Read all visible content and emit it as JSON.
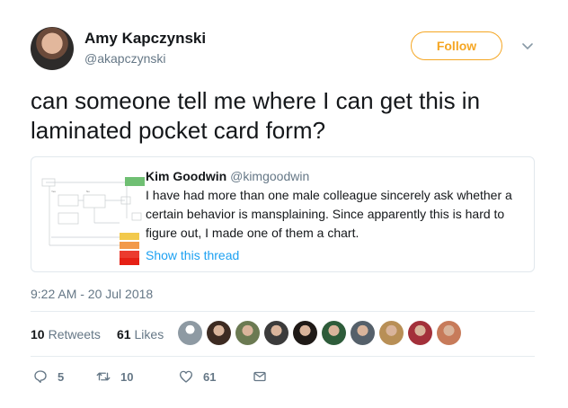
{
  "author": {
    "name": "Amy Kapczynski",
    "handle": "@akapczynski"
  },
  "follow_label": "Follow",
  "tweet_text": "can someone tell me where I can get this in laminated pocket card form?",
  "quoted": {
    "name": "Kim Goodwin",
    "handle": "@kimgoodwin",
    "text": "I have had more than one male colleague sincerely ask whether a certain behavior is mansplaining. Since apparently this is hard to figure out, I made one of them a chart.",
    "show_thread": "Show this thread",
    "thumb_labels": [
      "Yes",
      "No",
      "Yes",
      "No",
      "Yes"
    ]
  },
  "timestamp": "9:22 AM - 20 Jul 2018",
  "stats": {
    "retweets_count": "10",
    "retweets_label": "Retweets",
    "likes_count": "61",
    "likes_label": "Likes"
  },
  "likers": [
    {
      "color": "#8e9aa3"
    },
    {
      "color": "#3d2b22"
    },
    {
      "color": "#6b7a52"
    },
    {
      "color": "#3b3b3b"
    },
    {
      "color": "#1f1a17"
    },
    {
      "color": "#2e5c3a"
    },
    {
      "color": "#55606a"
    },
    {
      "color": "#b88f56"
    },
    {
      "color": "#a3303a"
    },
    {
      "color": "#c77b5a"
    }
  ],
  "actions": {
    "reply_count": "5",
    "retweet_count": "10",
    "like_count": "61"
  },
  "colors": {
    "follow_orange": "#f5a623",
    "link_blue": "#1da1f2",
    "muted": "#657786"
  }
}
